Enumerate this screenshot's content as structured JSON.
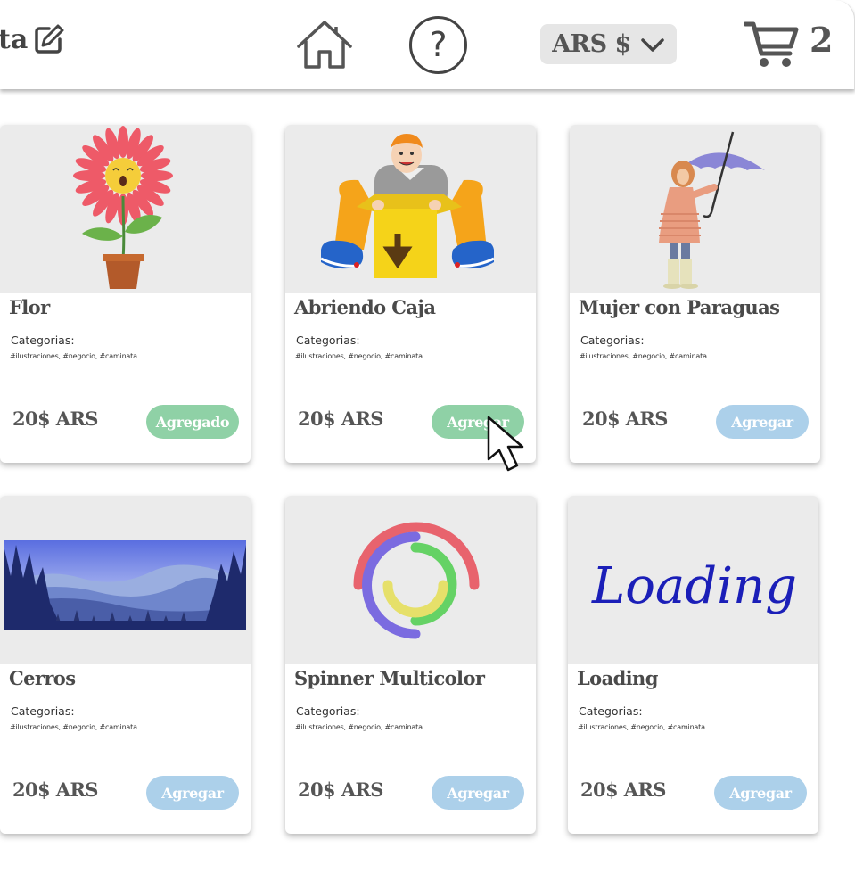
{
  "header": {
    "brand_text": "ta",
    "currency_label": "ARS $",
    "cart_count": "2"
  },
  "icons": {
    "edit": "edit-icon",
    "home": "home-icon",
    "help": "help-icon",
    "chevron": "chevron-down-icon",
    "cart": "cart-icon",
    "cursor": "mouse-cursor-icon"
  },
  "colors": {
    "added_button": "#8fd1a6",
    "default_button": "#acd0ea",
    "card_image_bg": "#ebebeb"
  },
  "products": [
    {
      "title": "Flor",
      "categories_label": "Categorias:",
      "tags": "#ilustraciones, #negocio, #caminata",
      "price": "20$ ARS",
      "button": "Agregado",
      "state": "added"
    },
    {
      "title": "Abriendo Caja",
      "categories_label": "Categorias:",
      "tags": "#ilustraciones, #negocio, #caminata",
      "price": "20$ ARS",
      "button": "Agregar",
      "state": "hover"
    },
    {
      "title": "Mujer con Paraguas",
      "categories_label": "Categorias:",
      "tags": "#ilustraciones, #negocio, #caminata",
      "price": "20$ ARS",
      "button": "Agregar",
      "state": "default"
    },
    {
      "title": "Cerros",
      "categories_label": "Categorias:",
      "tags": "#ilustraciones, #negocio, #caminata",
      "price": "20$ ARS",
      "button": "Agregar",
      "state": "default"
    },
    {
      "title": "Spinner Multicolor",
      "categories_label": "Categorias:",
      "tags": "#ilustraciones, #negocio, #caminata",
      "price": "20$ ARS",
      "button": "Agregar",
      "state": "default"
    },
    {
      "title": "Loading",
      "categories_label": "Categorias:",
      "tags": "#ilustraciones, #negocio, #caminata",
      "price": "20$ ARS",
      "button": "Agregar",
      "state": "default",
      "image_text": "Loading"
    }
  ]
}
